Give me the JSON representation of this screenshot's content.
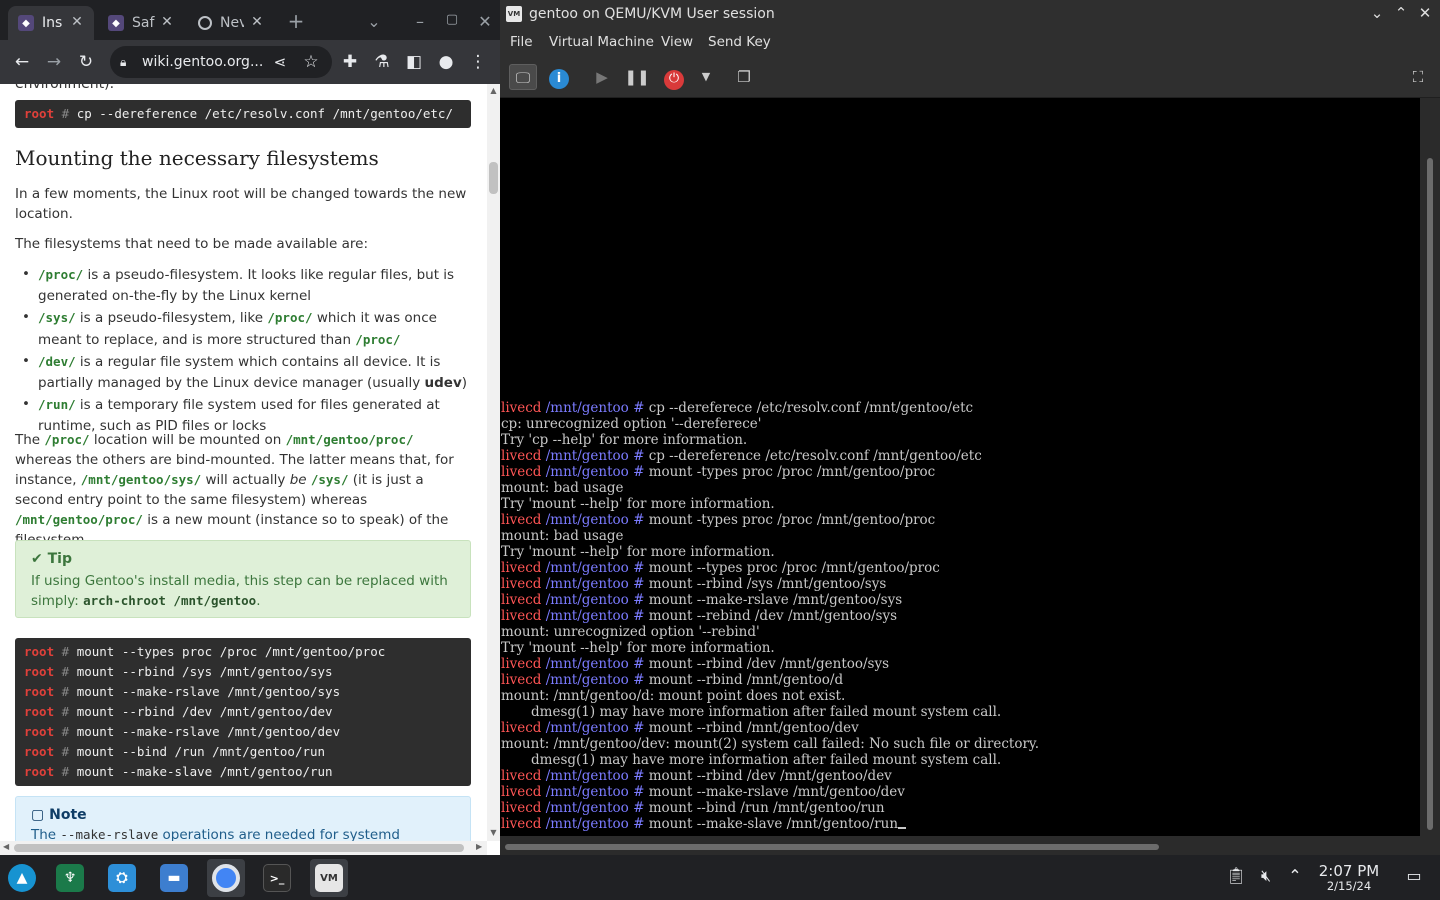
{
  "browser": {
    "tabs": [
      {
        "label": "Ins",
        "active": true
      },
      {
        "label": "Saf",
        "active": false
      },
      {
        "label": "Nev",
        "active": false
      }
    ],
    "new_tab": "+",
    "url": "wiki.gentoo.org...",
    "content": {
      "cut_top_text": "environment).",
      "code1": {
        "prompt_user": "root",
        "prompt_hash": "#",
        "cmd": "cp --dereference /etc/resolv.conf /mnt/gentoo/etc/"
      },
      "heading": "Mounting the necessary filesystems",
      "para1": "In a few moments, the Linux root will be changed towards the new location.",
      "para2": "The filesystems that need to be made available are:",
      "list": [
        {
          "code": "/proc/",
          "text1": " is a pseudo-filesystem. It looks like regular files, but is generated on-the-fly by the Linux kernel"
        },
        {
          "code": "/sys/",
          "text1": " is a pseudo-filesystem, like ",
          "code2": "/proc/",
          "text2": " which it was once meant to replace, and is more structured than ",
          "code3": "/proc/"
        },
        {
          "code": "/dev/",
          "text1": " is a regular file system which contains all device. It is partially managed by the Linux device manager (usually ",
          "bold": "udev",
          "text2": ")"
        },
        {
          "code": "/run/",
          "text1": " is a temporary file system used for files generated at runtime, such as PID files or locks"
        }
      ],
      "para3": {
        "t1": "The ",
        "c1": "/proc/",
        "t2": " location will be mounted on ",
        "c2": "/mnt/gentoo/proc/",
        "t3": " whereas the others are bind-mounted. The latter means that, for instance, ",
        "c3": "/mnt/gentoo/sys/",
        "t4": " will actually ",
        "em": "be",
        "c4": "/sys/",
        "t5": " (it is just a second entry point to the same filesystem) whereas ",
        "c5": "/mnt/gentoo/proc/",
        "t6": " is a new mount (instance so to speak) of the filesystem."
      },
      "tip": {
        "title": "Tip",
        "text": "If using Gentoo's install media, this step can be replaced with simply: ",
        "code": "arch-chroot /mnt/gentoo",
        "end": "."
      },
      "code2": [
        "mount --types proc /proc /mnt/gentoo/proc",
        "mount --rbind /sys /mnt/gentoo/sys",
        "mount --make-rslave /mnt/gentoo/sys",
        "mount --rbind /dev /mnt/gentoo/dev",
        "mount --make-rslave /mnt/gentoo/dev",
        "mount --bind /run /mnt/gentoo/run",
        "mount --make-slave /mnt/gentoo/run"
      ],
      "code2_user": "root",
      "code2_hash": "#",
      "note": {
        "title": "Note",
        "t1": "The ",
        "code": "--make-rslave",
        "t2": " operations are needed for systemd"
      }
    }
  },
  "vm": {
    "title": "gentoo on QEMU/KVM User session",
    "app_icon_text": "VM",
    "menu": [
      "File",
      "Virtual Machine",
      "View",
      "Send Key"
    ],
    "console_lines": [
      {
        "kind": "cmd",
        "text": "cp --dereferece /etc/resolv.conf /mnt/gentoo/etc"
      },
      {
        "kind": "out",
        "text": "cp: unrecognized option '--dereferece'"
      },
      {
        "kind": "out",
        "text": "Try 'cp --help' for more information."
      },
      {
        "kind": "cmd",
        "text": "cp --dereference /etc/resolv.conf /mnt/gentoo/etc"
      },
      {
        "kind": "cmd",
        "text": "mount -types proc /proc /mnt/gentoo/proc"
      },
      {
        "kind": "out",
        "text": "mount: bad usage"
      },
      {
        "kind": "out",
        "text": "Try 'mount --help' for more information."
      },
      {
        "kind": "cmd",
        "text": "mount -types proc /proc /mnt/gentoo/proc"
      },
      {
        "kind": "out",
        "text": "mount: bad usage"
      },
      {
        "kind": "out",
        "text": "Try 'mount --help' for more information."
      },
      {
        "kind": "cmd",
        "text": "mount --types proc /proc /mnt/gentoo/proc"
      },
      {
        "kind": "cmd",
        "text": "mount --rbind /sys /mnt/gentoo/sys"
      },
      {
        "kind": "cmd",
        "text": "mount --make-rslave /mnt/gentoo/sys"
      },
      {
        "kind": "cmd",
        "text": "mount --rebind /dev /mnt/gentoo/sys"
      },
      {
        "kind": "out",
        "text": "mount: unrecognized option '--rebind'"
      },
      {
        "kind": "out",
        "text": "Try 'mount --help' for more information."
      },
      {
        "kind": "cmd",
        "text": "mount --rbind /dev /mnt/gentoo/sys"
      },
      {
        "kind": "cmd",
        "text": "mount --rbind /mnt/gentoo/d"
      },
      {
        "kind": "out",
        "text": "mount: /mnt/gentoo/d: mount point does not exist."
      },
      {
        "kind": "out",
        "text": "       dmesg(1) may have more information after failed mount system call."
      },
      {
        "kind": "cmd",
        "text": "mount --rbind /mnt/gentoo/dev"
      },
      {
        "kind": "out",
        "text": "mount: /mnt/gentoo/dev: mount(2) system call failed: No such file or directory."
      },
      {
        "kind": "out",
        "text": "       dmesg(1) may have more information after failed mount system call."
      },
      {
        "kind": "cmd",
        "text": "mount --rbind /dev /mnt/gentoo/dev"
      },
      {
        "kind": "cmd",
        "text": "mount --make-rslave /mnt/gentoo/dev"
      },
      {
        "kind": "cmd",
        "text": "mount --bind /run /mnt/gentoo/run"
      },
      {
        "kind": "cmd",
        "text": "mount --make-slave /mnt/gentoo/run",
        "cursor": true
      }
    ],
    "prompt_user": "livecd",
    "prompt_path": "/mnt/gentoo",
    "prompt_hash": "#"
  },
  "taskbar": {
    "time": "2:07 PM",
    "date": "2/15/24"
  },
  "colors": {
    "prompt_user": "#ff5555",
    "prompt_path": "#7b7bff",
    "code_green": "#2e7d32",
    "tip_bg": "#dff0d8",
    "note_bg": "#e1f1fb"
  }
}
